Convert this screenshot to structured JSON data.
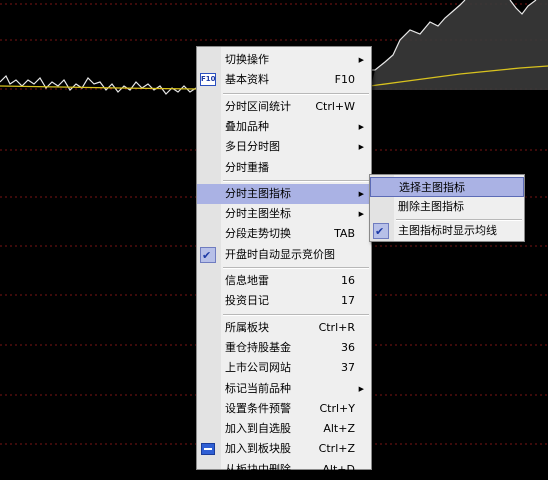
{
  "colors": {
    "price_line": "#e8e8e8",
    "avg_line": "#d8c21e",
    "grid": "#8b1a1a",
    "highlight": "#aab2e4"
  },
  "main_menu": [
    {
      "id": "switch-op",
      "label": "切换操作",
      "shortcut": "",
      "submenu": true
    },
    {
      "id": "basic-info",
      "label": "基本资料",
      "shortcut": "F10",
      "icon": "f10-icon",
      "icon_text": "F10"
    },
    {
      "sep": true
    },
    {
      "id": "interval-stats",
      "label": "分时区间统计",
      "shortcut": "Ctrl+W"
    },
    {
      "id": "overlay-variety",
      "label": "叠加品种",
      "shortcut": "",
      "submenu": true
    },
    {
      "id": "multi-day",
      "label": "多日分时图",
      "shortcut": "",
      "submenu": true
    },
    {
      "id": "replay",
      "label": "分时重播",
      "shortcut": ""
    },
    {
      "sep": true
    },
    {
      "id": "main-indicator",
      "label": "分时主图指标",
      "shortcut": "",
      "submenu": true,
      "highlighted": true
    },
    {
      "id": "main-coord",
      "label": "分时主图坐标",
      "shortcut": "",
      "submenu": true
    },
    {
      "id": "segment-switch",
      "label": "分段走势切换",
      "shortcut": "TAB"
    },
    {
      "id": "auction-chart",
      "label": "开盘时自动显示竞价图",
      "shortcut": "",
      "checked": true
    },
    {
      "sep": true
    },
    {
      "id": "info-mine",
      "label": "信息地雷",
      "shortcut": "16"
    },
    {
      "id": "investment-diary",
      "label": "投资日记",
      "shortcut": "17"
    },
    {
      "sep": true
    },
    {
      "id": "belonging-block",
      "label": "所属板块",
      "shortcut": "Ctrl+R"
    },
    {
      "id": "heavy-funds",
      "label": "重仓持股基金",
      "shortcut": "36"
    },
    {
      "id": "company-site",
      "label": "上市公司网站",
      "shortcut": "37"
    },
    {
      "id": "mark-variety",
      "label": "标记当前品种",
      "shortcut": "",
      "submenu": true
    },
    {
      "id": "condition-alert",
      "label": "设置条件预警",
      "shortcut": "Ctrl+Y"
    },
    {
      "id": "add-favorites",
      "label": "加入到自选股",
      "shortcut": "Alt+Z"
    },
    {
      "id": "add-block",
      "label": "加入到板块股",
      "shortcut": "Ctrl+Z",
      "icon": "add-to-block-icon"
    },
    {
      "id": "remove-block",
      "label": "从板块中删除",
      "shortcut": "Alt+D"
    }
  ],
  "sub_menu": [
    {
      "id": "select-indicator",
      "label": "选择主图指标",
      "highlighted": true
    },
    {
      "id": "delete-indicator",
      "label": "删除主图指标"
    },
    {
      "sep": true
    },
    {
      "id": "show-avg",
      "label": "主图指标时显示均线",
      "checked": true
    }
  ],
  "glyphs": {
    "submenu_arrow": "▶",
    "check": "✔"
  }
}
